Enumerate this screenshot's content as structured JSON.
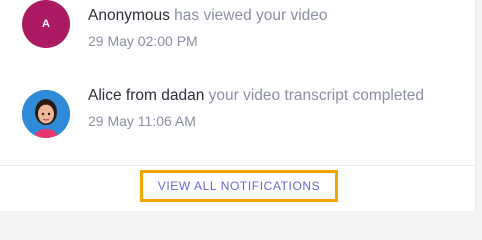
{
  "notifications": [
    {
      "avatar_text": "A",
      "actor": "Anonymous",
      "message": " has viewed your video",
      "time": "29 May 02:00 PM"
    },
    {
      "actor": "Alice from dadan",
      "message": " your video transcript completed",
      "time": "29 May 11:06 AM"
    }
  ],
  "footer": {
    "view_all_label": "VIEW ALL NOTIFICATIONS"
  },
  "colors": {
    "accent": "#6a66d6",
    "highlight": "#f6a300",
    "avatar_a": "#ac1a64"
  }
}
